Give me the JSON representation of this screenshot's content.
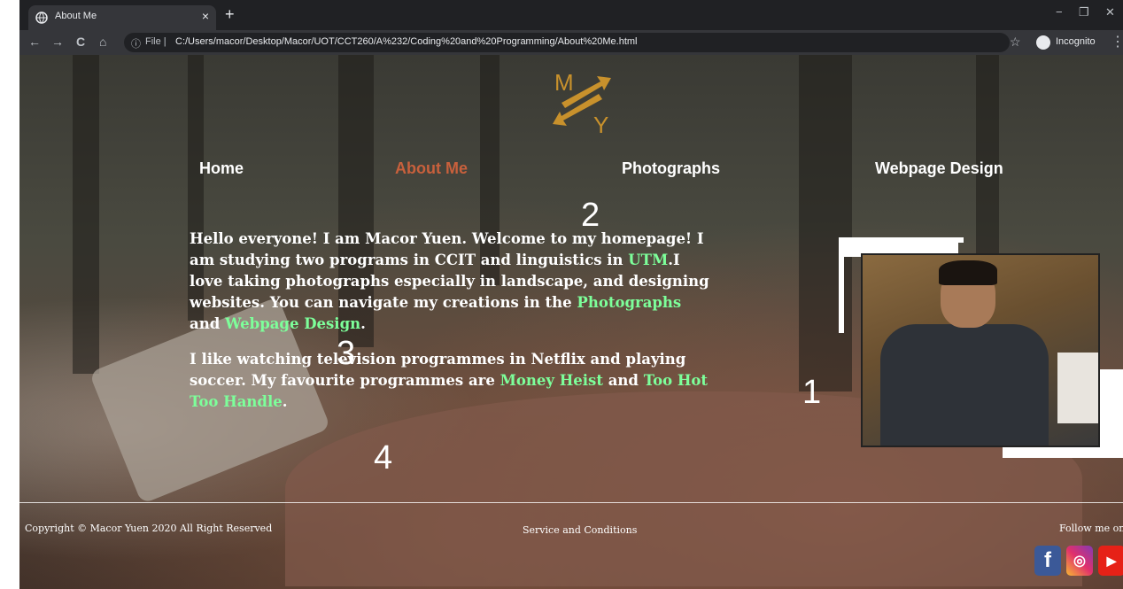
{
  "browser": {
    "tab_title": "About Me",
    "tab_close": "×",
    "new_tab": "+",
    "omnibox_info": "ⓘ",
    "omnibox_label": "File |",
    "url": "C:/Users/macor/Desktop/Macor/UOT/CCT260/A%232/Coding%20and%20Programming/About%20Me.html",
    "profile_label": "Incognito",
    "back": "←",
    "forward": "→",
    "reload": "C",
    "home": "⌂",
    "star": "☆",
    "menu": "⋮",
    "minimize": "−",
    "restore": "❐",
    "close": "✕"
  },
  "logo": {
    "letter_top": "M",
    "letter_bottom": "Y",
    "color": "#c8912c"
  },
  "nav": {
    "items": [
      {
        "label": "Home"
      },
      {
        "label": "About Me",
        "active": true
      },
      {
        "label": "Photographs"
      },
      {
        "label": "Webpage Design"
      }
    ],
    "active_color": "#c8603c"
  },
  "bio": {
    "p1_a": "Hello everyone! I am Macor Yuen. Welcome to my homepage! I am studying two programs in CCIT and linguistics in ",
    "p1_link1": "UTM",
    "p1_b": ".I love taking photographs especially in landscape, and designing websites. You can navigate my creations in the ",
    "p1_link2": "Photographs",
    "p1_c": " and ",
    "p1_link3": "Webpage Design",
    "p1_d": ".",
    "p2_a": "I like watching television programmes in Netflix and playing soccer. My favourite programmes are ",
    "p2_link1": "Money Heist",
    "p2_b": " and ",
    "p2_link2": "Too Hot Too Handle",
    "p2_c": ".",
    "link_color": "#7dff9a"
  },
  "markers": {
    "m1": "1",
    "m2": "2",
    "m3": "3",
    "m4": "4"
  },
  "footer": {
    "copyright": "Copyright © Macor Yuen 2020 All Right Reserved",
    "terms": "Service and Conditions",
    "follow": "Follow me on",
    "social": {
      "facebook": "f",
      "instagram": "◎",
      "youtube": "▶"
    }
  }
}
